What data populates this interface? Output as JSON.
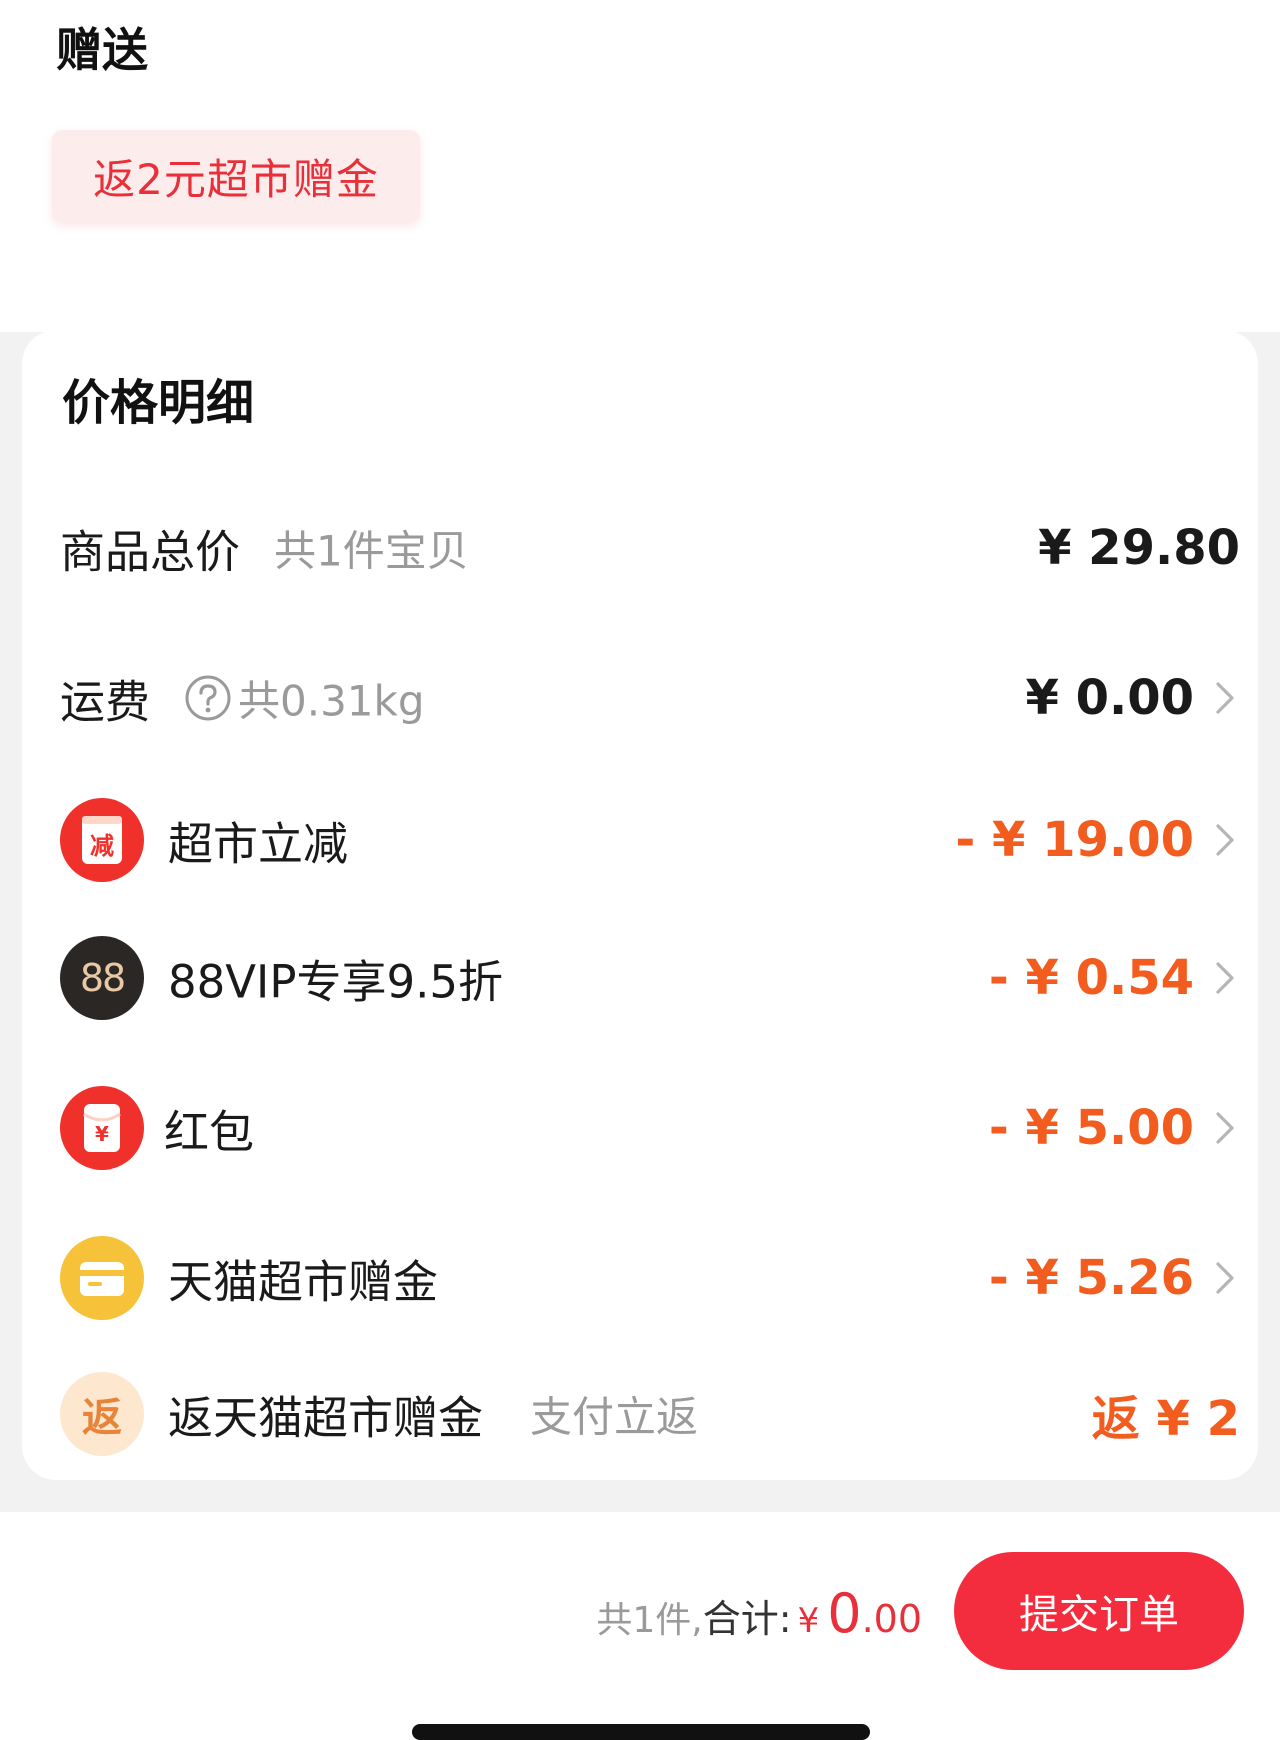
{
  "gift": {
    "title": "赠送",
    "tag": "返2元超市赠金"
  },
  "price_detail": {
    "title": "价格明细",
    "goods_total": {
      "label": "商品总价",
      "note": "共1件宝贝",
      "amount": "¥ 29.80"
    },
    "shipping": {
      "label": "运费",
      "note": "共0.31kg",
      "amount": "¥ 0.00",
      "icon": "question-icon"
    },
    "discounts": [
      {
        "label": "超市立减",
        "amount": "- ¥ 19.00",
        "icon": "jian-badge-icon",
        "icon_text": "减",
        "icon_color": "#f0302b"
      },
      {
        "label": "88VIP专享9.5折",
        "amount": "- ¥ 0.54",
        "icon": "vip-88-icon",
        "icon_text": "88",
        "icon_color": "#2b2725"
      },
      {
        "label": "红包",
        "amount": "- ¥ 5.00",
        "icon": "red-envelope-icon",
        "icon_text": "¥",
        "icon_color": "#f0302b"
      },
      {
        "label": "天猫超市赠金",
        "amount": "- ¥ 5.26",
        "icon": "wallet-card-icon",
        "icon_color": "#f6c23a"
      }
    ],
    "rebate": {
      "label": "返天猫超市赠金",
      "note": "支付立返",
      "amount": "返 ¥ 2",
      "icon": "fan-badge-icon",
      "icon_text": "返"
    }
  },
  "footer": {
    "count": "共1件,",
    "total_label": "合计:",
    "currency": "¥",
    "total_int": "0",
    "total_dec": ".00",
    "submit": "提交订单"
  },
  "colors": {
    "accent_red": "#f42d3e",
    "discount_orange": "#f25c1f",
    "muted_text": "#9a9a9a"
  }
}
